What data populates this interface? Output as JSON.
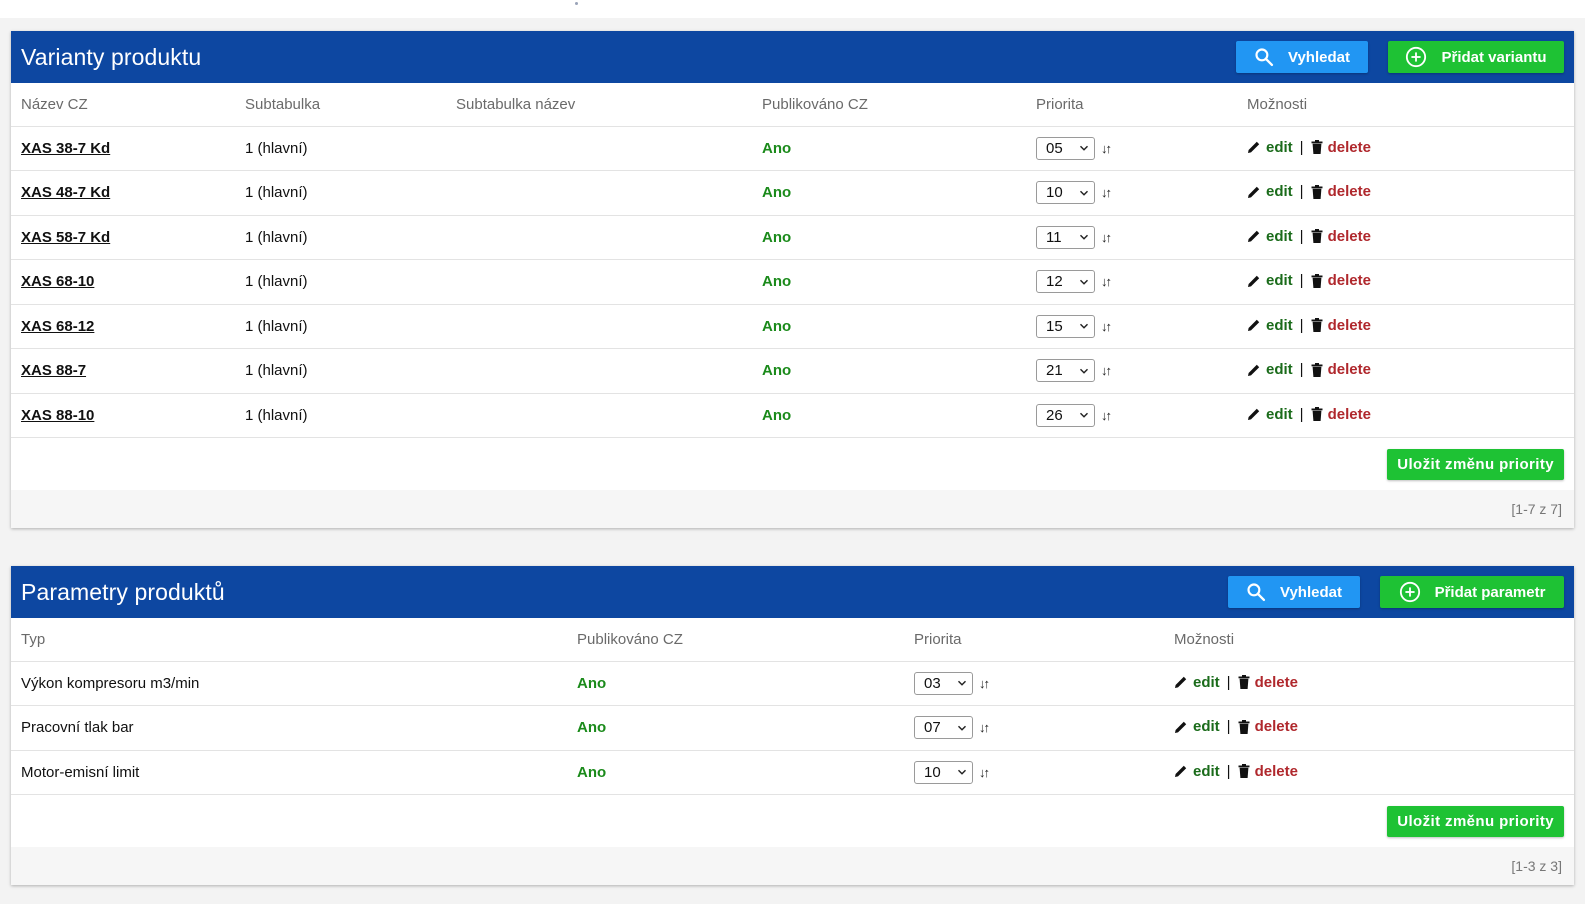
{
  "variants": {
    "title": "Varianty produktu",
    "search_label": "Vyhledat",
    "add_label": "Přidat variantu",
    "columns": [
      "Název CZ",
      "Subtabulka",
      "Subtabulka název",
      "Publikováno CZ",
      "Priorita",
      "Možnosti"
    ],
    "rows": [
      {
        "name": "XAS 38-7 Kd",
        "subtable": "1 (hlavní)",
        "subtable_name": "",
        "published": "Ano",
        "priority": "05"
      },
      {
        "name": "XAS 48-7 Kd",
        "subtable": "1 (hlavní)",
        "subtable_name": "",
        "published": "Ano",
        "priority": "10"
      },
      {
        "name": "XAS 58-7 Kd",
        "subtable": "1 (hlavní)",
        "subtable_name": "",
        "published": "Ano",
        "priority": "11"
      },
      {
        "name": "XAS 68-10",
        "subtable": "1 (hlavní)",
        "subtable_name": "",
        "published": "Ano",
        "priority": "12"
      },
      {
        "name": "XAS 68-12",
        "subtable": "1 (hlavní)",
        "subtable_name": "",
        "published": "Ano",
        "priority": "15"
      },
      {
        "name": "XAS 88-7",
        "subtable": "1 (hlavní)",
        "subtable_name": "",
        "published": "Ano",
        "priority": "21"
      },
      {
        "name": "XAS 88-10",
        "subtable": "1 (hlavní)",
        "subtable_name": "",
        "published": "Ano",
        "priority": "26"
      }
    ],
    "edit_label": "edit",
    "separator": "|",
    "delete_label": "delete",
    "save_label": "Uložit změnu priority",
    "pager": "[1-7 z 7]"
  },
  "params": {
    "title": "Parametry produktů",
    "search_label": "Vyhledat",
    "add_label": "Přidat parametr",
    "columns": [
      "Typ",
      "Publikováno CZ",
      "Priorita",
      "Možnosti"
    ],
    "rows": [
      {
        "type": "Výkon kompresoru m3/min",
        "published": "Ano",
        "priority": "03"
      },
      {
        "type": "Pracovní tlak bar",
        "published": "Ano",
        "priority": "07"
      },
      {
        "type": "Motor-emisní limit",
        "published": "Ano",
        "priority": "10"
      }
    ],
    "edit_label": "edit",
    "separator": "|",
    "delete_label": "delete",
    "save_label": "Uložit změnu priority",
    "pager": "[1-3 z 3]"
  },
  "colors": {
    "header_bg": "#0d47a1",
    "search_btn": "#2196f3",
    "add_btn": "#1ec234",
    "published_green": "#1a8a1a",
    "edit_green": "#1a6b1a",
    "delete_red": "#b0282d"
  },
  "icons": {
    "search": "search-icon",
    "add": "plus-circle-icon",
    "edit": "pencil-icon",
    "delete": "trash-icon",
    "sort": "sort-arrows-icon",
    "dropdown": "chevron-down-icon"
  }
}
